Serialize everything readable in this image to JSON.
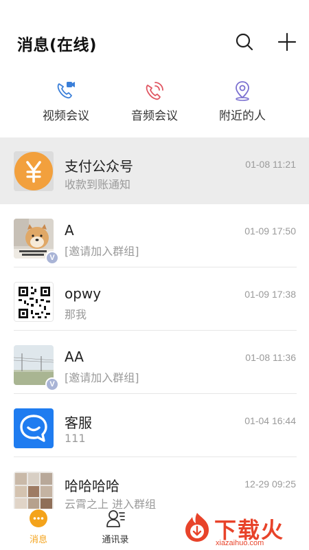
{
  "header": {
    "title": "消息(在线)",
    "search_icon": "search-icon",
    "add_icon": "plus-icon"
  },
  "quick_actions": [
    {
      "label": "视频会议",
      "icon": "video-call-icon",
      "color": "#3b7fd9"
    },
    {
      "label": "音频会议",
      "icon": "phone-call-icon",
      "color": "#e05561"
    },
    {
      "label": "附近的人",
      "icon": "location-pin-icon",
      "color": "#7a6fd0"
    }
  ],
  "conversations": [
    {
      "name": "支付公众号",
      "preview": "收款到账通知",
      "time": "01-08 11:21",
      "highlighted": true,
      "avatar": "yen-icon"
    },
    {
      "name": "A",
      "preview": "[邀请加入群组]",
      "time": "01-09 17:50",
      "badge": "V",
      "avatar": "shiba-photo"
    },
    {
      "name": "opwy",
      "preview": "那我",
      "time": "01-09 17:38",
      "avatar": "qr-code"
    },
    {
      "name": "AA",
      "preview": "[邀请加入群组]",
      "time": "01-08 11:36",
      "badge": "V",
      "avatar": "landscape-photo"
    },
    {
      "name": "客服",
      "preview": "111",
      "time": "01-04 16:44",
      "avatar": "chat-bubble-icon"
    },
    {
      "name": "哈哈哈哈",
      "preview": "云霄之上 进入群组",
      "time": "12-29 09:25",
      "avatar": "group-collage"
    }
  ],
  "tabs": [
    {
      "label": "消息",
      "icon": "chat-dots-icon",
      "active": true
    },
    {
      "label": "通讯录",
      "icon": "contacts-icon",
      "active": false
    }
  ],
  "watermark": {
    "text": "下载火",
    "url_text": "xiazaihuo.com"
  },
  "colors": {
    "accent": "#f4a31b",
    "highlight_bg": "#ececec",
    "customer_service_blue": "#1f7cf0"
  }
}
